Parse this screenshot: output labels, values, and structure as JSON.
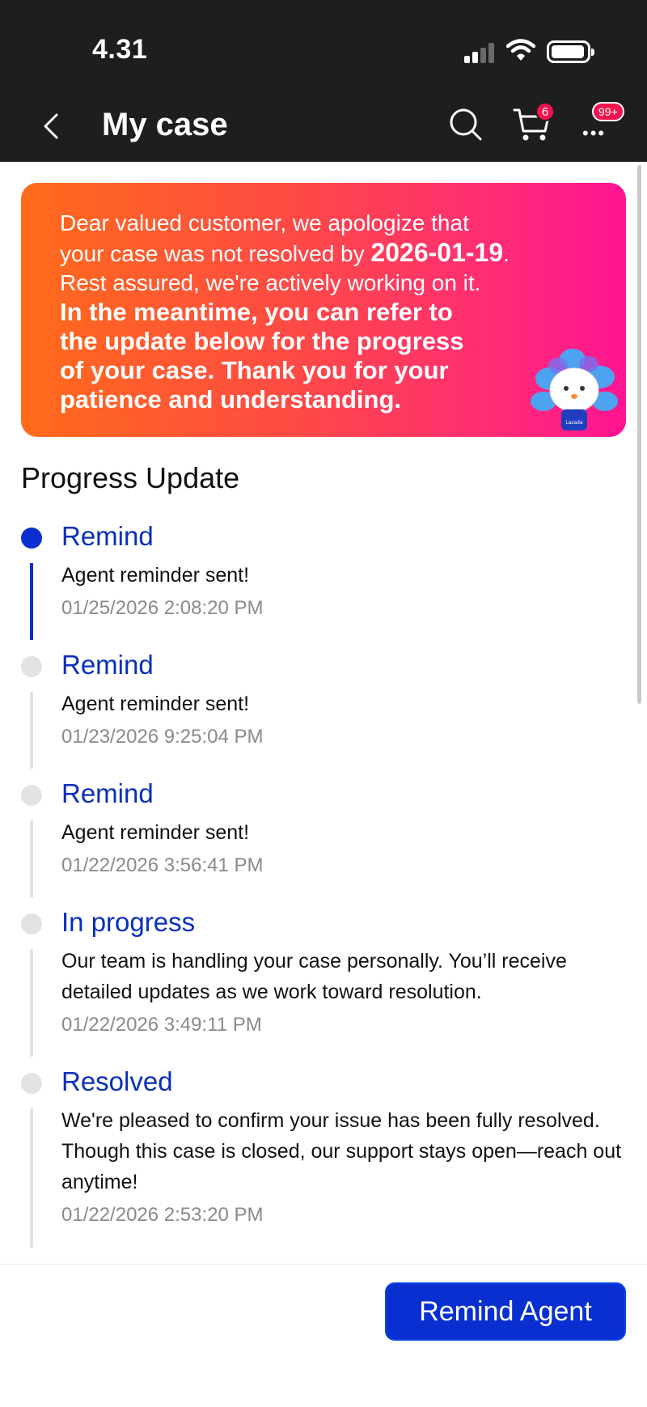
{
  "status_bar": {
    "time": "4.31"
  },
  "header": {
    "title": "My case",
    "cart_count": "6",
    "notifications": "99+"
  },
  "banner": {
    "line1": "Dear valued customer, we apologize that",
    "line2_prefix": "your case was not resolved by ",
    "date": "2026-01-19",
    "line2_suffix": ".",
    "line3": "Rest assured, we're actively working on it.",
    "bold_lines": [
      "In the meantime, you can refer to",
      "the update below for the progress",
      "of your case. Thank you for your",
      "patience and understanding."
    ],
    "mascot_text": "Lazada"
  },
  "progress": {
    "title": "Progress Update",
    "items": [
      {
        "status": "Remind",
        "message": "Agent reminder sent!",
        "time": "01/25/2026 2:08:20 PM",
        "active": true
      },
      {
        "status": "Remind",
        "message": "Agent reminder sent!",
        "time": "01/23/2026 9:25:04 PM",
        "active": false
      },
      {
        "status": "Remind",
        "message": "Agent reminder sent!",
        "time": "01/22/2026 3:56:41 PM",
        "active": false
      },
      {
        "status": "In progress",
        "message": "Our team is handling your case personally. You’ll receive detailed updates as we work toward resolution.",
        "time": "01/22/2026 3:49:11 PM",
        "active": false
      },
      {
        "status": "Resolved",
        "message": "We're pleased to confirm your issue has been fully resolved. Though this case is closed, our support stays open—reach out anytime!",
        "time": "01/22/2026 2:53:20 PM",
        "active": false
      }
    ]
  },
  "actions": {
    "remind_label": "Remind Agent"
  },
  "colors": {
    "accent": "#0a2fd1",
    "badge": "#f0134d",
    "banner_start": "#ff6b1a",
    "banner_end": "#ff1493"
  }
}
